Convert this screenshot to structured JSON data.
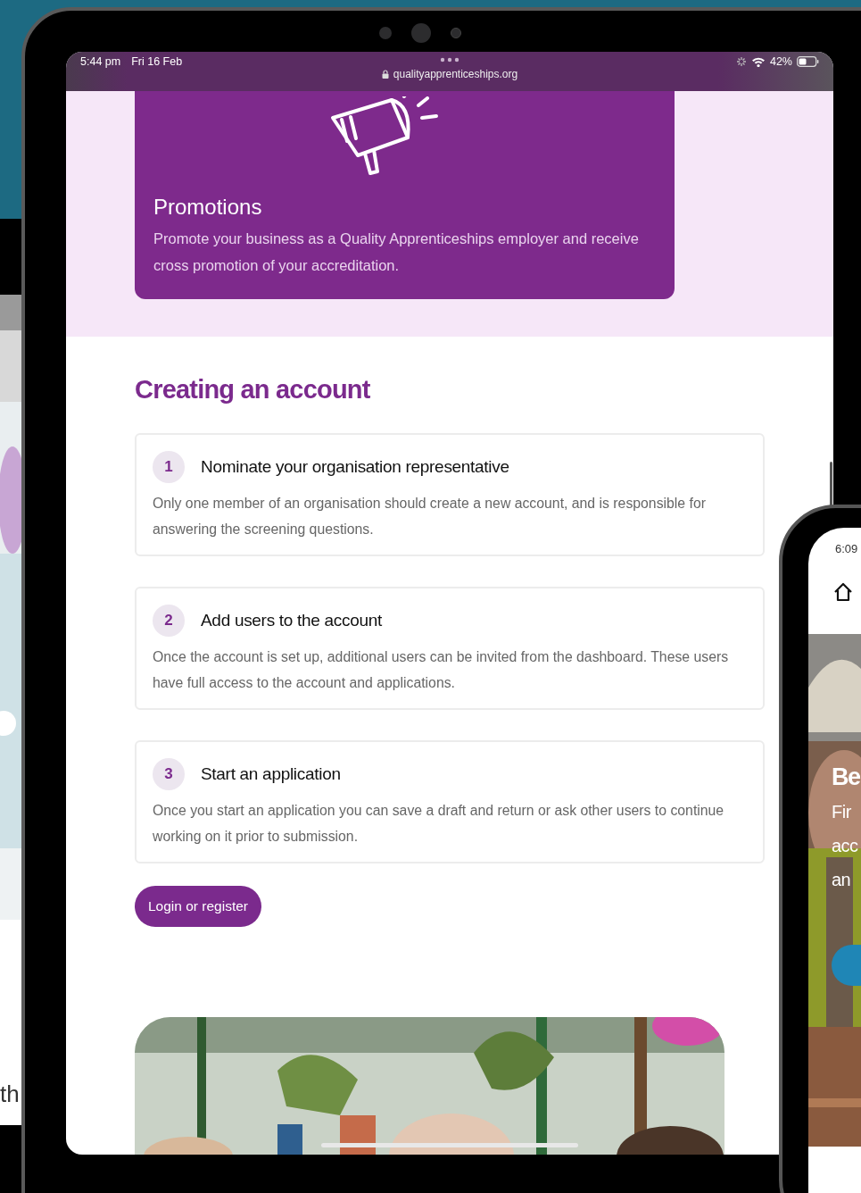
{
  "left_screen": {
    "text": "th"
  },
  "tablet": {
    "status_bar": {
      "time": "5:44 pm",
      "date": "Fri 16 Feb",
      "url": "qualityapprenticeships.org",
      "battery": "42%"
    },
    "promo_card": {
      "title": "Promotions",
      "text": "Promote your business as a Quality Apprenticeships employer and receive cross promotion of your accreditation."
    },
    "section": {
      "heading": "Creating an account",
      "steps": [
        {
          "number": "1",
          "title": "Nominate your organisation representative",
          "text": "Only one member of an organisation should create a new account, and is responsible for answering the screening questions."
        },
        {
          "number": "2",
          "title": "Add users to the account",
          "text": "Once the account is set up, additional users can be invited from the dashboard. These users have full access to the account and applications."
        },
        {
          "number": "3",
          "title": "Start an application",
          "text": "Once you start an application you can save a draft and return or ask other users to continue working on it prior to submission."
        }
      ],
      "button": "Login or register"
    }
  },
  "phone": {
    "time": "6:09",
    "hero_heading": "Be",
    "hero_lines": [
      "Fir",
      "acc",
      "an"
    ]
  }
}
